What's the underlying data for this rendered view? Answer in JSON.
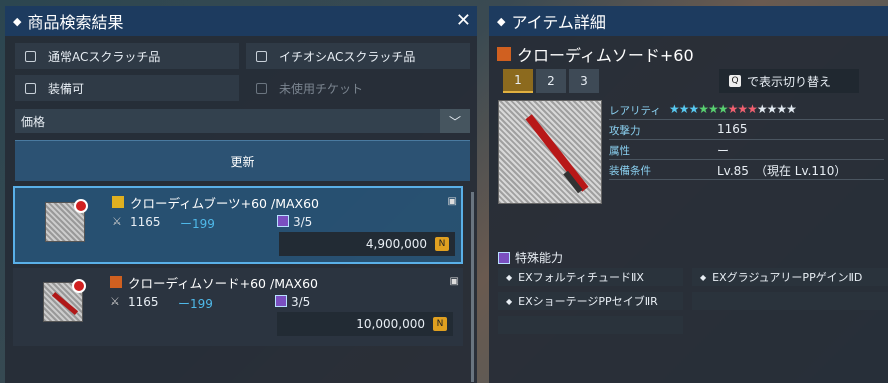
{
  "search_panel": {
    "title": "商品検索結果",
    "close": "✕",
    "filters": [
      {
        "label": "通常ACスクラッチ品"
      },
      {
        "label": "イチオシACスクラッチ品"
      },
      {
        "label": "装備可"
      },
      {
        "label": "未使用チケット",
        "disabled": true
      }
    ],
    "sort_select": {
      "value": "価格",
      "arrow": "﹀"
    },
    "refresh_label": "更新",
    "results": [
      {
        "name": "クローディムブーツ+60 /MAX60",
        "attack": "1165",
        "diff": "ー199",
        "slots": "3/5",
        "price": "4,900,000",
        "selected": true
      },
      {
        "name": "クローディムソード+60 /MAX60",
        "attack": "1165",
        "diff": "ー199",
        "slots": "3/5",
        "price": "10,000,000",
        "selected": false
      }
    ]
  },
  "detail_panel": {
    "title": "アイテム詳細",
    "item_name": "クローディムソード+60",
    "tabs": [
      "1",
      "2",
      "3"
    ],
    "toggle": {
      "key": "Q",
      "label": "で表示切り替え"
    },
    "stats": [
      {
        "key": "レアリティ",
        "value": ""
      },
      {
        "key": "攻撃力",
        "value": "1165"
      },
      {
        "key": "属性",
        "value": "ー"
      },
      {
        "key": "装備条件",
        "value": "Lv.85　（現在 Lv.110）"
      }
    ],
    "special_title": "特殊能力",
    "abilities": [
      "EXフォルティチュードⅡX",
      "EXグラジュアリーPPゲインⅡD",
      "EXショーテージPPセイブⅡR",
      ""
    ]
  },
  "colors": {
    "accent": "#1d3b5f",
    "selected_border": "#5ab0e8",
    "diff": "#4fb8e8"
  }
}
